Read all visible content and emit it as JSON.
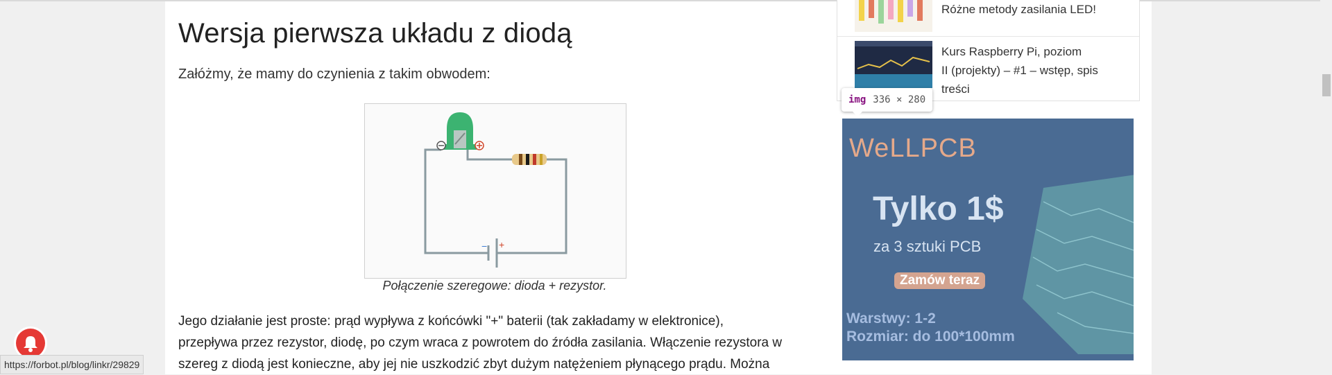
{
  "article": {
    "heading": "Wersja pierwsza układu z diodą",
    "intro": "Załóżmy, że mamy do czynienia z takim obwodem:",
    "figure_caption": "Połączenie szeregowe: dioda + rezystor.",
    "body_lines": [
      "Jego działanie jest proste: prąd wypływa z końcówki \"+\" baterii (tak zakładamy w elektronice),",
      "przepływa przez rezystor, diodę, po czym wraca z powrotem do źródła zasilania. Włączenie rezystora w",
      "szereg z diodą jest konieczne, aby jej nie uszkodzić zbyt dużym natężeniem płynącego prądu. Można"
    ]
  },
  "sidebar": {
    "related": [
      {
        "title": "Różne metody zasilania LED!",
        "thumb_icon": "led-thumbnail"
      },
      {
        "title_lines": [
          "Kurs Raspberry Pi, poziom",
          "II (projekty) – #1 – wstęp, spis",
          "treści"
        ],
        "thumb_icon": "graph-thumbnail"
      }
    ]
  },
  "devtools_tooltip": {
    "tag": "img",
    "dimensions": "336 × 280"
  },
  "ad": {
    "brand_left": "WeLL",
    "brand_right": "PCB",
    "headline": "Tylko 1$",
    "subline": "za 3 sztuki PCB",
    "cta": "Zamów teraz",
    "spec_layers": "Warstwy: 1-2",
    "spec_size": "Rozmiar: do 100*100mm"
  },
  "status_bar": {
    "url": "https://forbot.pl/blog/linkr/29829"
  },
  "colors": {
    "ad_bg": "#4a6b93",
    "led": "#3cb371",
    "notification": "#e53935"
  }
}
